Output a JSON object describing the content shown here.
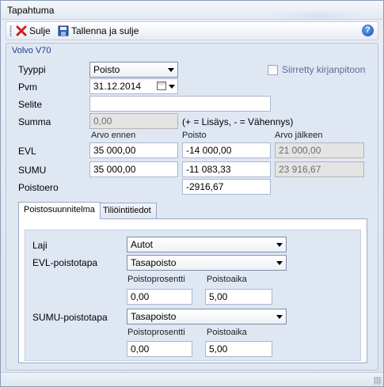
{
  "window": {
    "title": "Tapahtuma"
  },
  "toolbar": {
    "close_label": "Sulje",
    "save_close_label": "Tallenna ja sulje",
    "help_symbol": "?"
  },
  "group": {
    "title": "Volvo V70"
  },
  "form": {
    "tyyppi_label": "Tyyppi",
    "tyyppi_value": "Poisto",
    "pvm_label": "Pvm",
    "pvm_value": "31.12.2014",
    "selite_label": "Selite",
    "selite_value": "",
    "summa_label": "Summa",
    "summa_value": "0,00",
    "summa_hint": "(+ = Lisäys, - = Vähennys)",
    "siirretty_label": "Siirretty kirjanpitoon",
    "siirretty_checked": false
  },
  "table": {
    "col_before": "Arvo ennen",
    "col_depr": "Poisto",
    "col_after": "Arvo jälkeen",
    "rows": [
      {
        "label": "EVL",
        "before": "35 000,00",
        "depr": "-14 000,00",
        "after": "21 000,00"
      },
      {
        "label": "SUMU",
        "before": "35 000,00",
        "depr": "-11 083,33",
        "after": "23 916,67"
      }
    ],
    "diff_label": "Poistoero",
    "diff_value": "-2916,67"
  },
  "tabs": [
    {
      "label": "Poistosuunnitelma",
      "active": true
    },
    {
      "label": "Tiliöintitiedot",
      "active": false
    }
  ],
  "plan": {
    "laji_label": "Laji",
    "laji_value": "Autot",
    "evl_method_label": "EVL-poistotapa",
    "evl_method_value": "Tasapoisto",
    "evl_pct_label": "Poistoprosentti",
    "evl_pct_value": "0,00",
    "evl_time_label": "Poistoaika",
    "evl_time_value": "5,00",
    "sumu_method_label": "SUMU-poistotapa",
    "sumu_method_value": "Tasapoisto",
    "sumu_pct_label": "Poistoprosentti",
    "sumu_pct_value": "0,00",
    "sumu_time_label": "Poistoaika",
    "sumu_time_value": "5,00"
  }
}
